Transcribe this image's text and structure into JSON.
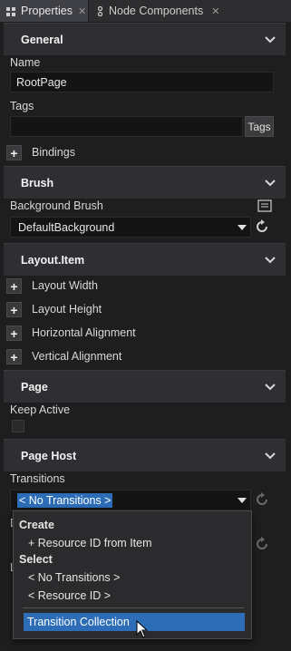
{
  "tabs": [
    {
      "label": "Properties",
      "icon": "properties-icon",
      "active": true
    },
    {
      "label": "Node Components",
      "icon": "node-components-icon",
      "active": false
    }
  ],
  "sections": {
    "general": {
      "title": "General"
    },
    "brush": {
      "title": "Brush"
    },
    "layout_item": {
      "title": "Layout.Item"
    },
    "page": {
      "title": "Page"
    },
    "page_host": {
      "title": "Page Host"
    }
  },
  "general": {
    "name_label": "Name",
    "name_value": "RootPage",
    "tags_label": "Tags",
    "tags_value": "",
    "tags_button": "Tags",
    "bindings_label": "Bindings"
  },
  "brush": {
    "background_brush_label": "Background Brush",
    "background_brush_value": "DefaultBackground"
  },
  "layout_item": {
    "rows": [
      "Layout Width",
      "Layout Height",
      "Horizontal Alignment",
      "Vertical Alignment"
    ]
  },
  "page": {
    "keep_active_label": "Keep Active",
    "keep_active_checked": false
  },
  "page_host": {
    "transitions_label": "Transitions",
    "transitions_value": "< No Transitions >",
    "hidden_label_1": "D",
    "hidden_label_2": "L"
  },
  "popup": {
    "create_header": "Create",
    "resource_from_item": "+ Resource ID from Item",
    "select_header": "Select",
    "no_transitions": "< No Transitions >",
    "resource_id": "< Resource ID >",
    "transition_collection": "Transition Collection"
  },
  "colors": {
    "accent": "#2d6db8",
    "background": "#1e1e1e",
    "section_header": "#2f2f33"
  }
}
